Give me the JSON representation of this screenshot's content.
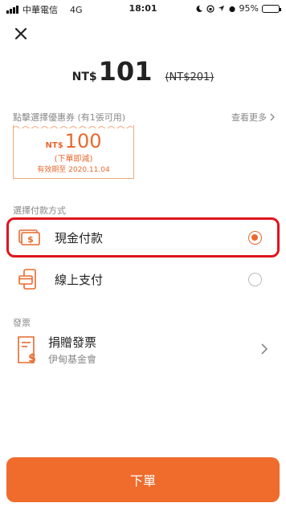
{
  "status_bar": {
    "carrier": "中華電信",
    "network": "4G",
    "time": "18:01",
    "battery": "95%",
    "battery_level": 0.95
  },
  "header": {
    "close_icon": "close-icon"
  },
  "price": {
    "currency": "NT$",
    "amount": "101",
    "original": "(NT$201)"
  },
  "coupon": {
    "hint": "點擊選擇優惠券 (有1張可用)",
    "more": "查看更多",
    "currency": "NT$",
    "value": "100",
    "condition": "(下單即減)",
    "expiry": "有效期至 2020.11.04"
  },
  "payment": {
    "section_label": "選擇付款方式",
    "options": [
      {
        "label": "現金付款",
        "icon": "cash-icon",
        "selected": true
      },
      {
        "label": "線上支付",
        "icon": "online-payment-icon",
        "selected": false
      }
    ]
  },
  "invoice": {
    "section_label": "發票",
    "title": "捐贈發票",
    "subtitle": "伊甸基金會",
    "icon": "invoice-icon"
  },
  "submit": {
    "label": "下單"
  },
  "colors": {
    "accent": "#ef6c2c",
    "highlight": "#e0141e"
  }
}
